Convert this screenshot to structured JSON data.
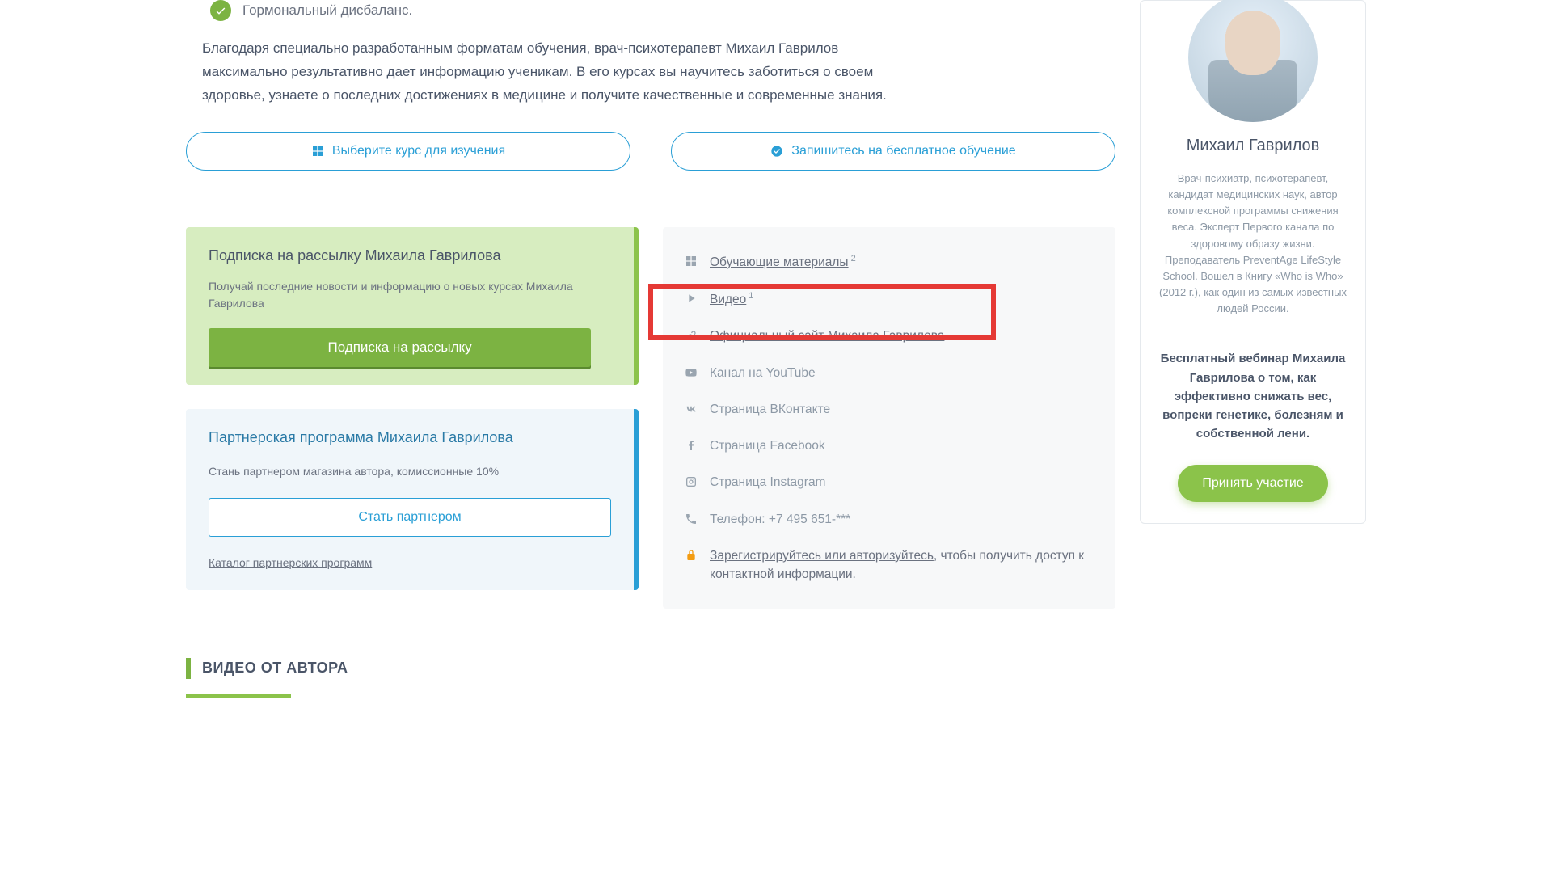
{
  "bullet": {
    "text": "Гормональный дисбаланс."
  },
  "intro": "Благодаря специально разработанным форматам обучения, врач-психотерапевт Михаил Гаврилов максимально результативно дает информацию ученикам. В его курсах вы научитесь заботиться о своем здоровье, узнаете о последних достижениях в медицине и получите качественные и современные знания.",
  "cta": {
    "choose": "Выберите курс для изучения",
    "enroll": "Запишитесь на бесплатное обучение"
  },
  "subscribe": {
    "title": "Подписка на рассылку Михаила Гаврилова",
    "desc": "Получай последние новости и информацию о новых курсах Михаила Гаврилова",
    "button": "Подписка на рассылку"
  },
  "partner": {
    "title": "Партнерская программа Михаила Гаврилова",
    "desc": "Стань партнером магазина автора, комиссионные 10%",
    "button": "Стать партнером",
    "catalog": "Каталог партнерских программ"
  },
  "links": {
    "materials": "Обучающие материалы",
    "materials_count": "2",
    "video": "Видео",
    "video_count": "1",
    "site": "Официальный сайт Михаила Гаврилова",
    "youtube": "Канал на YouTube",
    "vk": "Страница ВКонтакте",
    "fb": "Страница Facebook",
    "ig": "Страница Instagram",
    "phone_label": "Телефон: ",
    "phone": "+7 495 651-***",
    "lock_link": "Зарегистрируйтесь или авторизуйтесь",
    "lock_tail": ", чтобы получить доступ к контактной информации."
  },
  "section_video": "ВИДЕО ОТ АВТОРА",
  "sidebar": {
    "name": "Михаил Гаврилов",
    "bio": "Врач-психиатр, психотерапевт, кандидат медицинских наук, автор комплексной программы снижения веса. Эксперт Первого канала по здоровому образу жизни. Преподаватель PreventAge LifeStyle School. Вошел в Книгу «Who is Who» (2012 г.), как один из самых известных людей России.",
    "webinar": "Бесплатный вебинар Михаила Гаврилова о том, как эффективно снижать вес, вопреки генетике, болезням и собственной лени.",
    "button": "Принять участие"
  }
}
